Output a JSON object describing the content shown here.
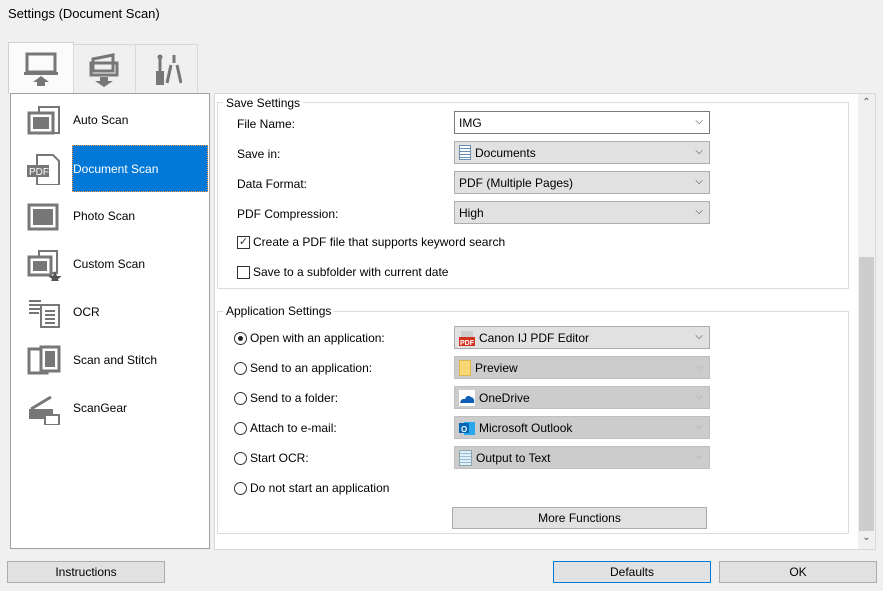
{
  "window": {
    "title": "Settings (Document Scan)"
  },
  "tabs": [
    {
      "name": "scan-from-computer",
      "selected": true
    },
    {
      "name": "scan-from-operation-panel",
      "selected": false
    },
    {
      "name": "general-settings",
      "selected": false
    }
  ],
  "sidebar": {
    "items": [
      {
        "label": "Auto Scan",
        "icon": "auto-scan-icon"
      },
      {
        "label": "Document Scan",
        "icon": "pdf-document-icon",
        "selected": true
      },
      {
        "label": "Photo Scan",
        "icon": "photo-scan-icon"
      },
      {
        "label": "Custom Scan",
        "icon": "custom-scan-icon"
      },
      {
        "label": "OCR",
        "icon": "ocr-icon"
      },
      {
        "label": "Scan and Stitch",
        "icon": "scan-stitch-icon"
      },
      {
        "label": "ScanGear",
        "icon": "scangear-icon"
      }
    ]
  },
  "save_settings": {
    "title": "Save Settings",
    "file_name_label": "File Name:",
    "file_name_value": "IMG",
    "save_in_label": "Save in:",
    "save_in_value": "Documents",
    "data_format_label": "Data Format:",
    "data_format_value": "PDF (Multiple Pages)",
    "pdf_compression_label": "PDF Compression:",
    "pdf_compression_value": "High",
    "keyword_search_label": "Create a PDF file that supports keyword search",
    "keyword_search_checked": true,
    "subfolder_label": "Save to a subfolder with current date",
    "subfolder_checked": false
  },
  "app_settings": {
    "title": "Application Settings",
    "options": [
      {
        "label": "Open with an application:",
        "value": "Canon IJ PDF Editor",
        "selected": true,
        "icon": "canon-pdf-editor-icon"
      },
      {
        "label": "Send to an application:",
        "value": "Preview",
        "selected": false,
        "icon": "folder-icon"
      },
      {
        "label": "Send to a folder:",
        "value": "OneDrive",
        "selected": false,
        "icon": "onedrive-icon"
      },
      {
        "label": "Attach to e-mail:",
        "value": "Microsoft Outlook",
        "selected": false,
        "icon": "outlook-icon"
      },
      {
        "label": "Start OCR:",
        "value": "Output to Text",
        "selected": false,
        "icon": "notepad-icon"
      },
      {
        "label": "Do not start an application",
        "selected": false
      }
    ],
    "more_functions": "More Functions"
  },
  "buttons": {
    "instructions": "Instructions",
    "defaults": "Defaults",
    "ok": "OK"
  },
  "colors": {
    "accent": "#0078d7"
  }
}
